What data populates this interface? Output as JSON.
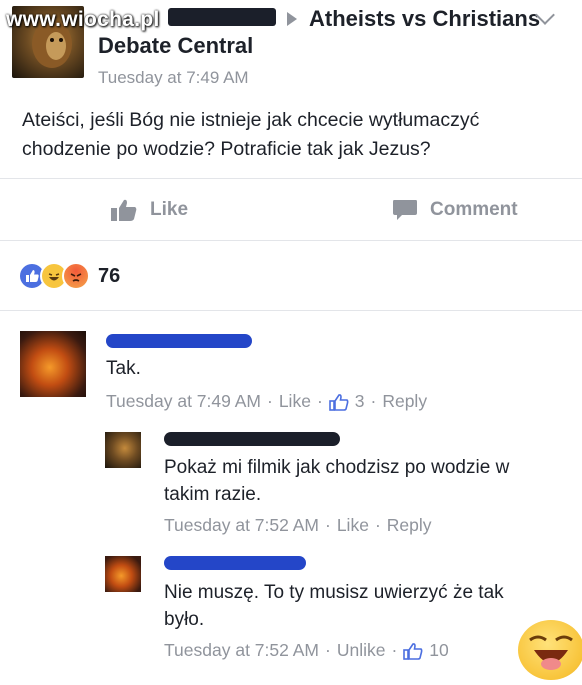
{
  "watermark": "www.wiocha.pl",
  "post": {
    "group": "Atheists vs Christians",
    "page": "Debate Central",
    "time": "Tuesday at 7:49 AM",
    "text": "Ateiści, jeśli Bóg nie istnieje jak chcecie wytłumaczyć chodzenie po wodzie? Potraficie tak jak Jezus?",
    "like_label": "Like",
    "comment_label": "Comment",
    "reaction_count": "76"
  },
  "comments": [
    {
      "text": "Tak.",
      "time": "Tuesday at 7:49 AM",
      "like": "Like",
      "likes": "3",
      "reply": "Reply"
    },
    {
      "text": "Pokaż mi filmik jak chodzisz po wodzie w takim razie.",
      "time": "Tuesday at 7:52 AM",
      "like": "Like",
      "reply": "Reply"
    },
    {
      "text": "Nie muszę. To ty musisz uwierzyć że tak było.",
      "time": "Tuesday at 7:52 AM",
      "like": "Unlike",
      "likes": "10"
    }
  ],
  "colors": {
    "text": "#1d2129",
    "meta": "#90949c",
    "like_blue": "#4c6fe0"
  }
}
